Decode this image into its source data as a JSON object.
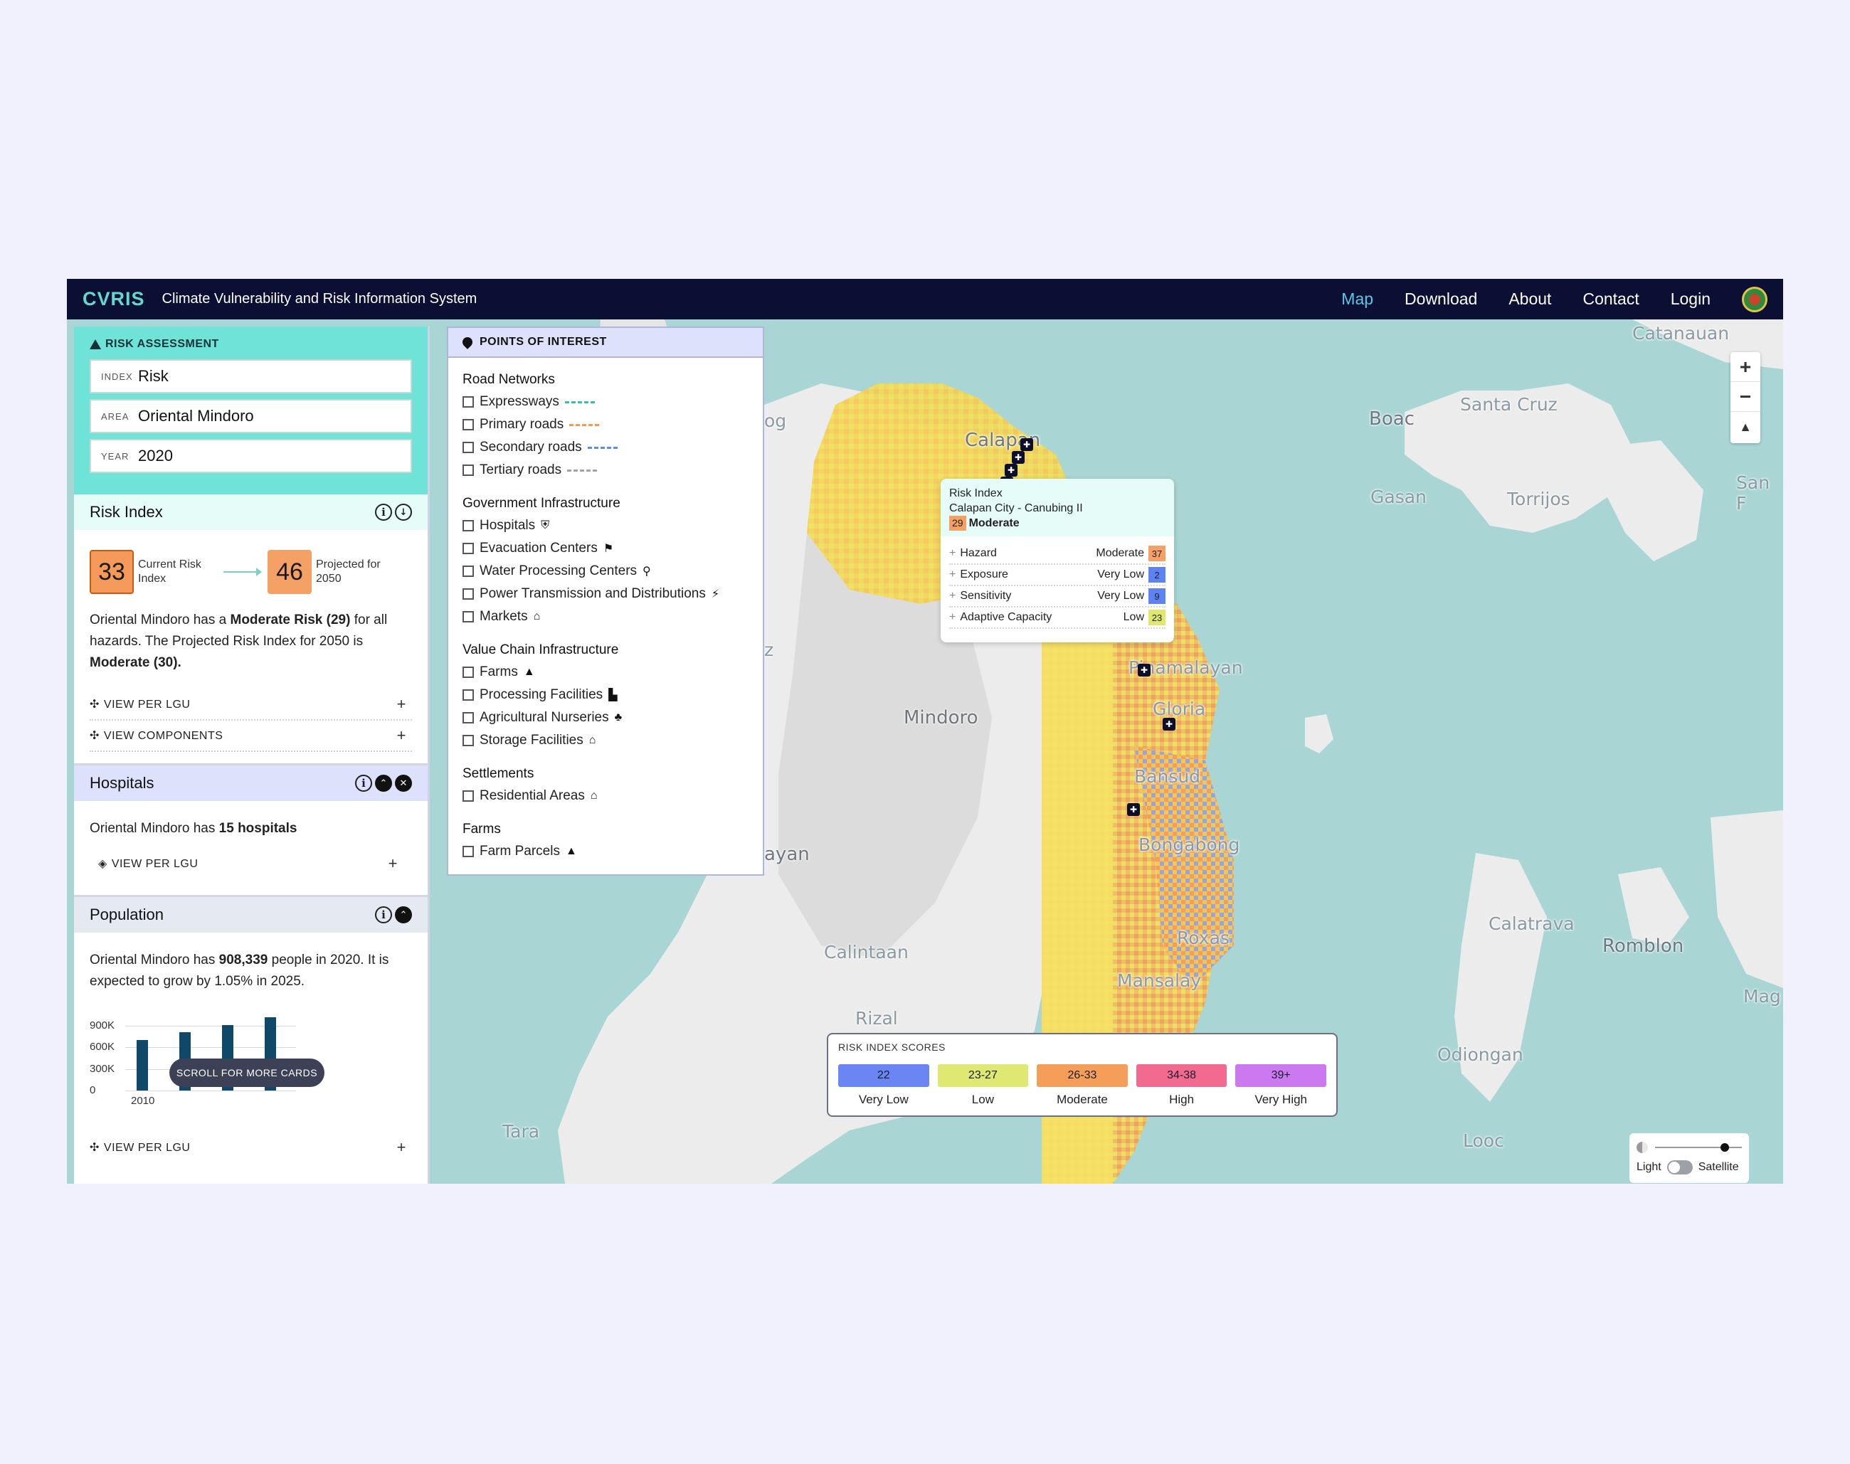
{
  "navbar": {
    "brand": "CVRIS",
    "subtitle": "Climate Vulnerability and Risk Information System",
    "links": [
      "Map",
      "Download",
      "About",
      "Contact",
      "Login"
    ]
  },
  "risk_assessment": {
    "caption": "RISK ASSESSMENT",
    "fields": [
      {
        "key": "INDEX",
        "value": "Risk"
      },
      {
        "key": "AREA",
        "value": "Oriental Mindoro"
      },
      {
        "key": "YEAR",
        "value": "2020"
      }
    ]
  },
  "risk_index_card": {
    "title": "Risk Index",
    "current_value": "33",
    "current_label": "Current Risk Index",
    "projected_value": "46",
    "projected_label": "Projected for 2050",
    "desc_pre": "Oriental Mindoro has a ",
    "desc_bold1": "Moderate Risk (29)",
    "desc_mid": " for all hazards. The Projected Risk Index for 2050 is ",
    "desc_bold2": "Moderate (30).",
    "view_per_lgu": "VIEW PER LGU",
    "view_components": "VIEW COMPONENTS"
  },
  "hospitals_card": {
    "title": "Hospitals",
    "desc_pre": "Oriental Mindoro has ",
    "desc_bold": "15 hospitals",
    "view_per_lgu": "VIEW PER LGU"
  },
  "population_card": {
    "title": "Population",
    "desc_pre": "Oriental Mindoro has ",
    "desc_bold": "908,339",
    "desc_post": " people in 2020. It is expected to grow by 1.05% in 2025.",
    "view_per_lgu": "VIEW PER LGU",
    "scroll_hint": "SCROLL FOR MORE CARDS"
  },
  "chart_data": {
    "type": "bar",
    "categories": [
      "2010",
      "",
      "",
      ""
    ],
    "values": [
      700000,
      810000,
      915000,
      1020000
    ],
    "y_ticks": [
      "900K",
      "600K",
      "300K",
      "0"
    ],
    "ylim": [
      0,
      1050000
    ],
    "title": "",
    "xlabel": "",
    "ylabel": ""
  },
  "poi": {
    "header": "POINTS OF INTEREST",
    "groups": [
      {
        "title": "Road Networks",
        "items": [
          {
            "label": "Expressways",
            "dash": "#3bbfa8"
          },
          {
            "label": "Primary roads",
            "dash": "#f29b52"
          },
          {
            "label": "Secondary roads",
            "dash": "#5a8fe0"
          },
          {
            "label": "Tertiary roads",
            "dash": "#a3a3a3"
          }
        ]
      },
      {
        "title": "Government Infrastructure",
        "items": [
          {
            "label": "Hospitals",
            "icon": "⛨"
          },
          {
            "label": "Evacuation Centers",
            "icon": "⚑"
          },
          {
            "label": "Water Processing Centers",
            "icon": "⚲"
          },
          {
            "label": "Power Transmission and Distributions",
            "icon": "⚡"
          },
          {
            "label": "Markets",
            "icon": "⌂"
          }
        ]
      },
      {
        "title": "Value Chain Infrastructure",
        "items": [
          {
            "label": "Farms",
            "icon": "▲"
          },
          {
            "label": "Processing Facilities",
            "icon": "▙"
          },
          {
            "label": "Agricultural Nurseries",
            "icon": "♣"
          },
          {
            "label": "Storage Facilities",
            "icon": "⌂"
          }
        ]
      },
      {
        "title": "Settlements",
        "items": [
          {
            "label": "Residential Areas",
            "icon": "⌂"
          }
        ]
      },
      {
        "title": "Farms",
        "items": [
          {
            "label": "Farm Parcels",
            "icon": "▲"
          }
        ]
      }
    ]
  },
  "tooltip": {
    "title": "Risk Index",
    "place": "Calapan City - Canubing II",
    "score": "29",
    "level": "Moderate",
    "rows": [
      {
        "label": "Hazard",
        "level": "Moderate",
        "score": "37",
        "color": "#f5a165"
      },
      {
        "label": "Exposure",
        "level": "Very Low",
        "score": "2",
        "color": "#5f82f2"
      },
      {
        "label": "Sensitivity",
        "level": "Very Low",
        "score": "9",
        "color": "#5f82f2"
      },
      {
        "label": "Adaptive Capacity",
        "level": "Low",
        "score": "23",
        "color": "#dfe86b"
      }
    ]
  },
  "legend": {
    "title": "RISK INDEX SCORES",
    "items": [
      {
        "range": "22",
        "label": "Very Low",
        "color": "#6b86f3"
      },
      {
        "range": "23-27",
        "label": "Low",
        "color": "#dee872"
      },
      {
        "range": "26-33",
        "label": "Moderate",
        "color": "#f49e5a"
      },
      {
        "range": "34-38",
        "label": "High",
        "color": "#f26a90"
      },
      {
        "range": "39+",
        "label": "Very High",
        "color": "#cb79f0"
      }
    ]
  },
  "basemap": {
    "light": "Light",
    "satellite": "Satellite",
    "opacity": 0.75
  },
  "map_labels": [
    "Catanauan",
    "Santa Cruz",
    "Boac",
    "Gasan",
    "Torrijos",
    "San F",
    "Calapan",
    "Pinamalayan",
    "Gloria",
    "Mindoro",
    "Bansud",
    "Bongabong",
    "Roxas",
    "Mansalay",
    "Calintaan",
    "Rizal",
    "Tara",
    "Calatrava",
    "Romblon",
    "Odiongan",
    "Looc",
    "Mag",
    "og",
    "ayan",
    "z"
  ]
}
